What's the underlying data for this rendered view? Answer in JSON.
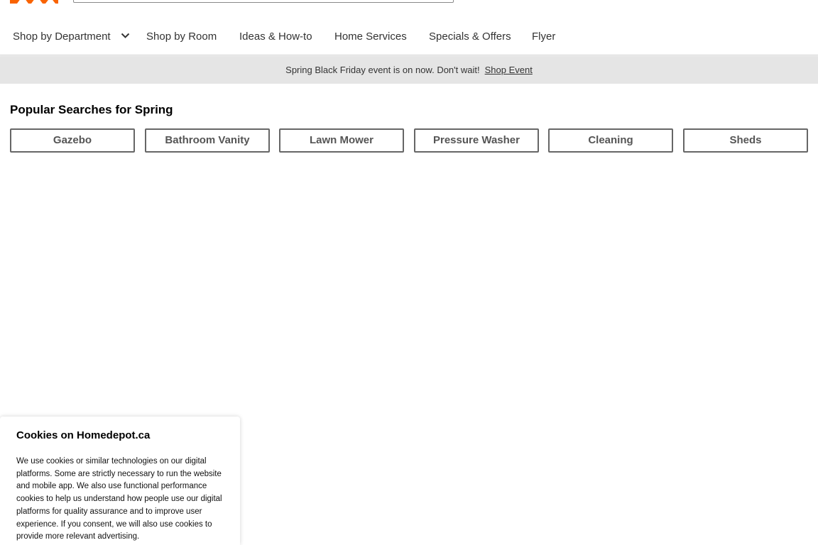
{
  "header": {
    "logo_icon": "home-depot-logo",
    "brand_color": "#f96302"
  },
  "nav": {
    "items": [
      {
        "label": "Shop by Department",
        "has_dropdown": true
      },
      {
        "label": "Shop by Room"
      },
      {
        "label": "Ideas & How-to"
      },
      {
        "label": "Home Services"
      },
      {
        "label": "Specials & Offers"
      },
      {
        "label": "Flyer"
      }
    ],
    "dropdown_icon": "chevron-down-icon"
  },
  "promo": {
    "text": "Spring Black Friday event is on now. Don't wait!",
    "link_label": "Shop Event",
    "background": "#e5e5e5"
  },
  "popular": {
    "title": "Popular Searches for Spring",
    "chips": [
      "Gazebo",
      "Bathroom Vanity",
      "Lawn Mower",
      "Pressure Washer",
      "Cleaning",
      "Sheds"
    ]
  },
  "cookies": {
    "title": "Cookies on Homedepot.ca",
    "body": "We use cookies or similar technologies on our digital platforms. Some are strictly necessary to run the website and mobile app. We also use functional performance cookies to help us understand how people use our digital platforms for quality assurance and to improve user experience. If you consent, we will also use cookies to provide more relevant advertising."
  }
}
